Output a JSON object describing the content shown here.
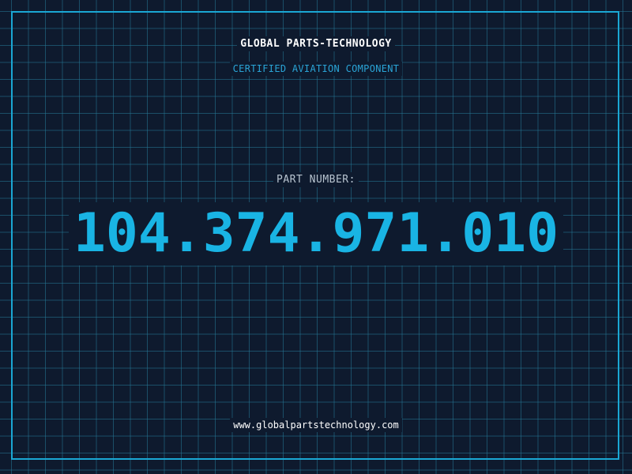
{
  "header": {
    "company": "GLOBAL PARTS-TECHNOLOGY",
    "tagline": "CERTIFIED AVIATION COMPONENT"
  },
  "part": {
    "label": "PART NUMBER:",
    "number": "104.374.971.010"
  },
  "footer": {
    "website": "www.globalpartstechnology.com"
  },
  "colors": {
    "background": "#0e1a2e",
    "accent": "#19b4e4",
    "grid": "#26788f"
  }
}
